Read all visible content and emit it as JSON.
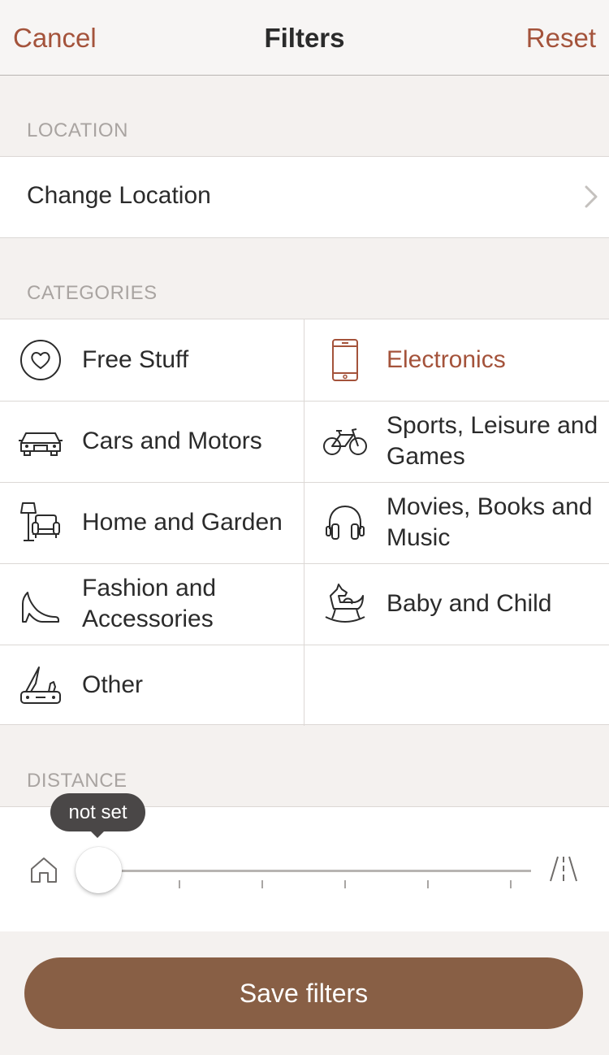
{
  "navbar": {
    "cancel_label": "Cancel",
    "title": "Filters",
    "reset_label": "Reset"
  },
  "location": {
    "header": "LOCATION",
    "change_label": "Change Location"
  },
  "categories": {
    "header": "CATEGORIES",
    "items": [
      {
        "label": "Free Stuff",
        "icon": "heart-icon",
        "selected": false
      },
      {
        "label": "Electronics",
        "icon": "phone-icon",
        "selected": true
      },
      {
        "label": "Cars and Motors",
        "icon": "car-icon",
        "selected": false
      },
      {
        "label": "Sports, Leisure and Games",
        "icon": "bicycle-icon",
        "selected": false
      },
      {
        "label": "Home and Garden",
        "icon": "lamp-armchair-icon",
        "selected": false
      },
      {
        "label": "Movies, Books and Music",
        "icon": "headphones-icon",
        "selected": false
      },
      {
        "label": "Fashion and Accessories",
        "icon": "high-heel-icon",
        "selected": false
      },
      {
        "label": "Baby and Child",
        "icon": "rocking-horse-icon",
        "selected": false
      },
      {
        "label": "Other",
        "icon": "swiss-knife-icon",
        "selected": false
      }
    ]
  },
  "distance": {
    "header": "DISTANCE",
    "value_label": "not set",
    "value_fraction": 0
  },
  "save_label": "Save filters",
  "colors": {
    "accent": "#a4533b",
    "button": "#885f45",
    "background": "#f4f1ef",
    "tooltip": "#4a4747"
  }
}
